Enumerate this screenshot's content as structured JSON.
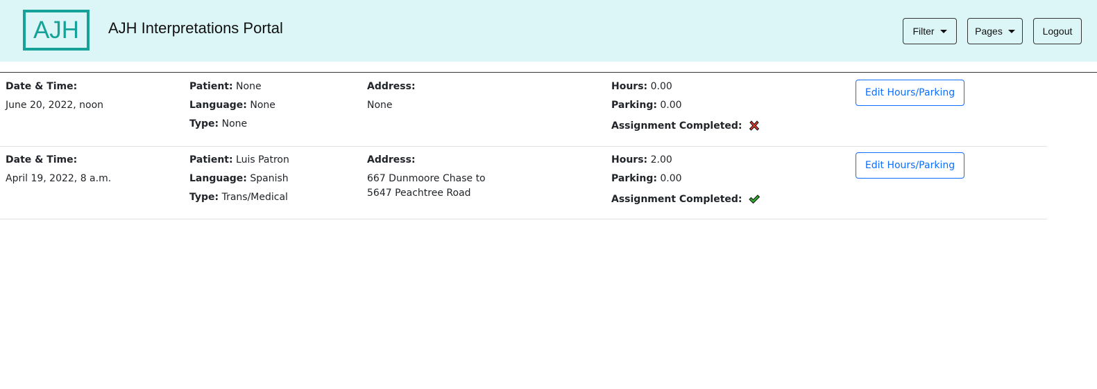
{
  "header": {
    "logo_text": "AJH",
    "title": "AJH Interpretations Portal",
    "filter_label": "Filter",
    "pages_label": "Pages",
    "logout_label": "Logout"
  },
  "labels": {
    "datetime": "Date & Time:",
    "patient": "Patient:",
    "language": "Language:",
    "type": "Type:",
    "address": "Address:",
    "hours": "Hours:",
    "parking": "Parking:",
    "completed": "Assignment Completed:",
    "edit": "Edit Hours/Parking"
  },
  "assignments": [
    {
      "datetime": "June 20, 2022, noon",
      "patient": "None",
      "language": "None",
      "type": "None",
      "address_line1": "None",
      "address_line2": "",
      "hours": "0.00",
      "parking": "0.00",
      "completed_icon": "x-mark-icon"
    },
    {
      "datetime": "April 19, 2022, 8 a.m.",
      "patient": "Luis Patron",
      "language": "Spanish",
      "type": "Trans/Medical",
      "address_line1": "667 Dunmoore Chase to",
      "address_line2": "5647 Peachtree Road",
      "hours": "2.00",
      "parking": "0.00",
      "completed_icon": "check-mark-icon"
    }
  ],
  "colors": {
    "header_bg": "#dcf5f6",
    "brand": "#17a299",
    "link_blue": "#0d6efd",
    "fail_red": "#e53b2c",
    "ok_green": "#2fae2f"
  }
}
